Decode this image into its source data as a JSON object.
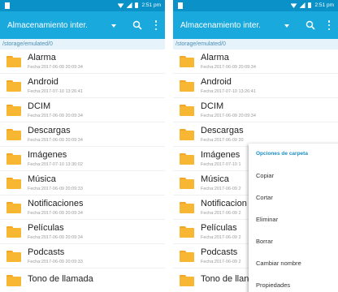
{
  "statusbar": {
    "time": "2:51 pm"
  },
  "appbar": {
    "title": "Almacenamiento inter."
  },
  "path": "/storage/emulated/0",
  "folders": [
    {
      "name": "Alarma",
      "date": "Fecha:2017-06-09 20:09:34"
    },
    {
      "name": "Android",
      "date": "Fecha:2017-07-10 13:26:41"
    },
    {
      "name": "DCIM",
      "date": "Fecha:2017-06-09 20:09:34"
    },
    {
      "name": "Descargas",
      "date": "Fecha:2017-06-09 20:09:34"
    },
    {
      "name": "Imágenes",
      "date": "Fecha:2017-07-10 13:30:02"
    },
    {
      "name": "Música",
      "date": "Fecha:2017-06-09 20:09:33"
    },
    {
      "name": "Notificaciones",
      "date": "Fecha:2017-06-09 20:09:34"
    },
    {
      "name": "Películas",
      "date": "Fecha:2017-06-09 20:09:34"
    },
    {
      "name": "Podcasts",
      "date": "Fecha:2017-06-09 20:09:33"
    },
    {
      "name": "Tono de llamada",
      "date": ""
    }
  ],
  "right_folders": [
    {
      "name": "Alarma",
      "date": "Fecha:2017-06-09 20:09:34"
    },
    {
      "name": "Android",
      "date": "Fecha:2017-07-10 13:26:41"
    },
    {
      "name": "DCIM",
      "date": "Fecha:2017-06-09 20:09:34"
    },
    {
      "name": "Descargas",
      "date": "Fecha:2017-06-09 20"
    },
    {
      "name": "Imágenes",
      "date": "Fecha:2017-07-10 1"
    },
    {
      "name": "Música",
      "date": "Fecha:2017-06-09 2"
    },
    {
      "name": "Notificacion",
      "date": "Fecha:2017-06-09 2"
    },
    {
      "name": "Películas",
      "date": "Fecha:2017-06-09 2"
    },
    {
      "name": "Podcasts",
      "date": "Fecha:2017-06-09 2"
    },
    {
      "name": "Tono de llan",
      "date": ""
    }
  ],
  "context_menu": {
    "title": "Opciones de carpeta",
    "items": [
      "Copiar",
      "Cortar",
      "Eliminar",
      "Borrar",
      "Cambiar nombre",
      "Propiedades"
    ]
  },
  "colors": {
    "statusbar": "#0a92c8",
    "appbar": "#19a9dc",
    "folder": "#f7b733",
    "menu_title": "#1b8fc6"
  },
  "icons": [
    "folder-icon",
    "search-icon",
    "more-vert-icon",
    "dropdown-arrow-icon",
    "wifi-icon",
    "signal-icon",
    "battery-icon"
  ]
}
